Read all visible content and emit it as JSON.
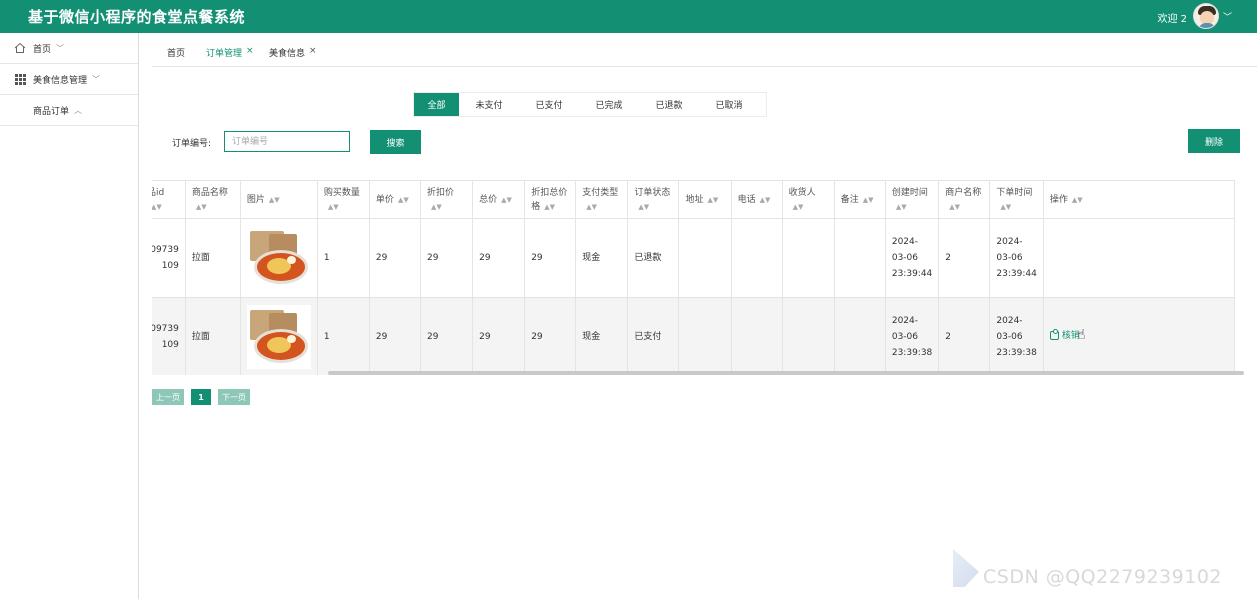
{
  "app": {
    "title": "基于微信小程序的食堂点餐系统",
    "welcome": "欢迎 2"
  },
  "sidebar": {
    "items": [
      {
        "label": "首页",
        "icon": "home-icon"
      },
      {
        "label": "美食信息管理",
        "icon": "grid-icon"
      },
      {
        "label": "商品订单",
        "icon": ""
      }
    ]
  },
  "tabs": [
    {
      "label": "首页"
    },
    {
      "label": "订单管理",
      "active": true
    },
    {
      "label": "美食信息"
    }
  ],
  "status_tabs": [
    "全部",
    "未支付",
    "已支付",
    "已完成",
    "已退款",
    "已取消"
  ],
  "search": {
    "label": "订单编号:",
    "placeholder": "订单编号",
    "button": "搜索",
    "delete_button": "删除"
  },
  "table": {
    "headers": [
      "品id",
      "商品名称",
      "图片",
      "购买数量",
      "单价",
      "折扣价",
      "总价",
      "折扣总价格",
      "支付类型",
      "订单状态",
      "地址",
      "电话",
      "收货人",
      "备注",
      "创建时间",
      "商户名称",
      "下单时间",
      "操作"
    ],
    "rows": [
      {
        "id": "09739\n109",
        "name": "拉面",
        "qty": "1",
        "price": "29",
        "discount": "29",
        "total": "29",
        "discount_total": "29",
        "pay_type": "现金",
        "status": "已退款",
        "address": "",
        "phone": "",
        "receiver": "",
        "remark": "",
        "created": "2024-03-06 23:39:44",
        "merchant": "2",
        "ordered": "2024-03-06 23:39:44",
        "op": ""
      },
      {
        "id": "09739\n109",
        "name": "拉面",
        "qty": "1",
        "price": "29",
        "discount": "29",
        "total": "29",
        "discount_total": "29",
        "pay_type": "现金",
        "status": "已支付",
        "address": "",
        "phone": "",
        "receiver": "",
        "remark": "",
        "created": "2024-03-06 23:39:38",
        "merchant": "2",
        "ordered": "2024-03-06 23:39:38",
        "op": "核销"
      }
    ]
  },
  "pager": {
    "prev": "上一页",
    "current": "1",
    "next": "下一页"
  },
  "watermark": "CSDN @QQ2279239102",
  "colors": {
    "primary": "#139074",
    "light": "#8cc7b8"
  }
}
